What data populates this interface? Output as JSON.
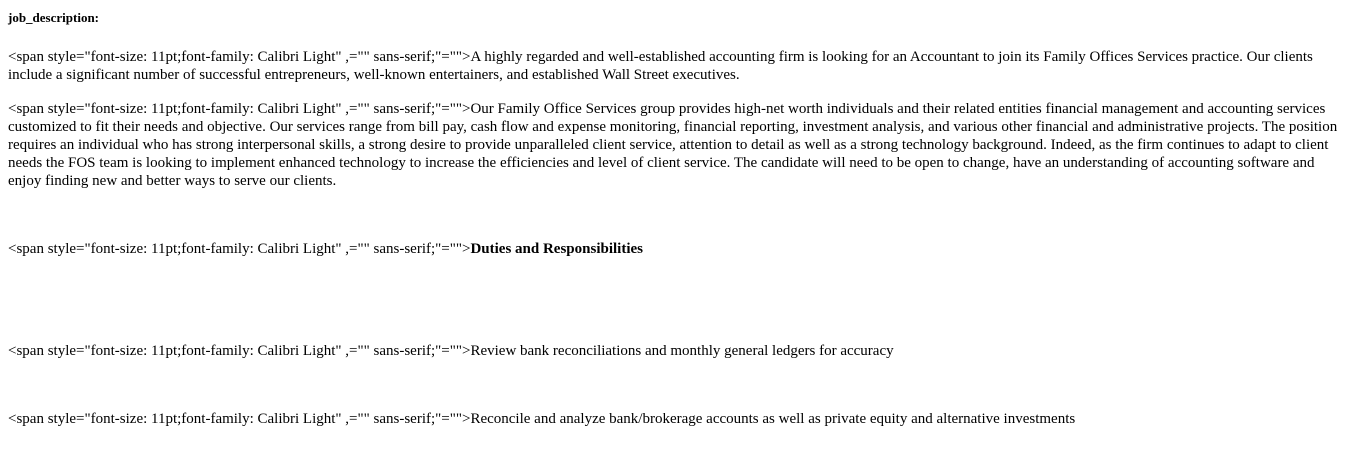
{
  "field_label": "job_description:",
  "paragraphs": [
    {
      "prefix": " <span style=\"font-size: 11pt;font-family: Calibri Light\" ,=\"\" sans-serif;\"=\"\">",
      "text": "A highly regarded and well-established accounting firm is looking for an Accountant to join its Family Offices Services practice. Our clients include a significant number of successful entrepreneurs, well-known entertainers, and established Wall Street executives."
    },
    {
      "prefix": "<span style=\"font-size: 11pt;font-family: Calibri Light\" ,=\"\" sans-serif;\"=\"\">",
      "text": "Our Family Office Services group provides high-net worth individuals and their related entities financial management and accounting services customized to fit their needs and objective. Our services range from bill pay, cash flow and expense monitoring, financial reporting, investment analysis, and various other financial and administrative projects. The position requires an individual who has strong interpersonal skills, a strong desire to provide unparalleled client service, attention to detail as well as a strong technology background. Indeed, as the firm continues to adapt to client needs the FOS team is looking to implement enhanced technology to increase the efficiencies and level of client service. The candidate will need to be open to change, have an understanding of accounting software and enjoy finding new and better ways to serve our clients."
    },
    {
      "prefix": "<span style=\"font-size: 11pt;font-family: Calibri Light\" ,=\"\" sans-serif;\"=\"\">",
      "text": "Duties and Responsibilities"
    },
    {
      "prefix": "<span style=\"font-size: 11pt;font-family: Calibri Light\" ,=\"\" sans-serif;\"=\"\">",
      "text": "Review bank reconciliations and monthly general ledgers for accuracy"
    },
    {
      "prefix": "<span style=\"font-size: 11pt;font-family: Calibri Light\" ,=\"\" sans-serif;\"=\"\">",
      "text": "Reconcile and analyze bank/brokerage accounts as well as private equity and alternative investments"
    }
  ]
}
